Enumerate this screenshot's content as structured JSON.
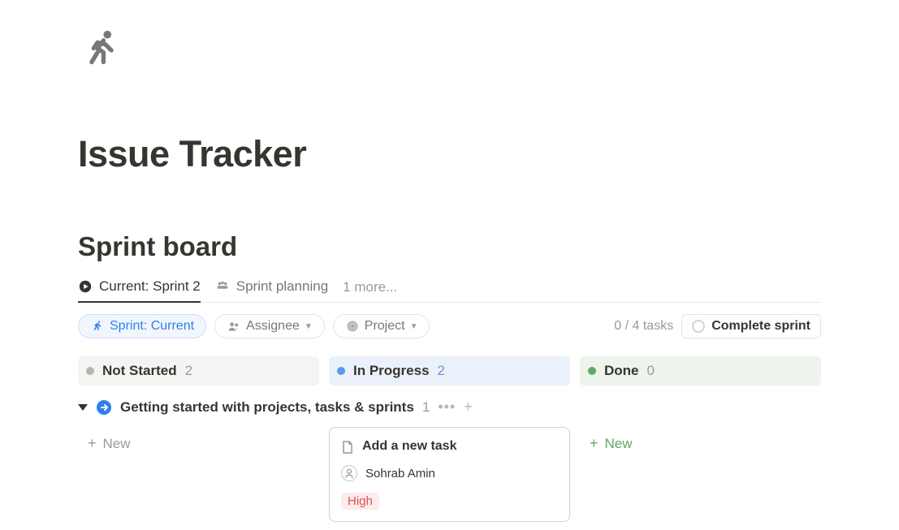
{
  "page": {
    "title": "Issue Tracker",
    "board_title": "Sprint board"
  },
  "tabs": {
    "current": {
      "label": "Current: Sprint 2"
    },
    "planning": {
      "label": "Sprint planning"
    },
    "more": {
      "label": "1 more..."
    }
  },
  "filters": {
    "sprint": {
      "label": "Sprint: Current"
    },
    "assignee": {
      "label": "Assignee"
    },
    "project": {
      "label": "Project"
    }
  },
  "status": {
    "task_count": "0 / 4 tasks",
    "complete_label": "Complete sprint"
  },
  "columns": {
    "not_started": {
      "name": "Not Started",
      "count": "2"
    },
    "in_progress": {
      "name": "In Progress",
      "count": "2"
    },
    "done": {
      "name": "Done",
      "count": "0"
    }
  },
  "group": {
    "name": "Getting started with projects, tasks & sprints",
    "count": "1"
  },
  "new_label": "New",
  "task": {
    "title": "Add a new task",
    "assignee": "Sohrab Amin",
    "priority": "High"
  }
}
